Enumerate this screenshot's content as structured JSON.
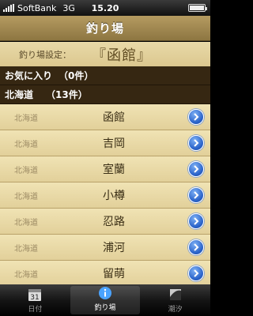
{
  "status": {
    "carrier": "SoftBank",
    "network": "3G",
    "time": "15.20"
  },
  "navbar": {
    "title": "釣り場"
  },
  "setting": {
    "label": "釣り場設定：",
    "value": "『函館』"
  },
  "sections": {
    "favorites": {
      "label": "お気に入り",
      "count": "（0件）"
    },
    "hokkaido": {
      "label": "北海道",
      "count": "（13件）"
    }
  },
  "list": [
    {
      "region": "北海道",
      "name": "函館"
    },
    {
      "region": "北海道",
      "name": "吉岡"
    },
    {
      "region": "北海道",
      "name": "室蘭"
    },
    {
      "region": "北海道",
      "name": "小樽"
    },
    {
      "region": "北海道",
      "name": "忍路"
    },
    {
      "region": "北海道",
      "name": "浦河"
    },
    {
      "region": "北海道",
      "name": "留萌"
    }
  ],
  "tabs": [
    {
      "label": "日付",
      "icon": "calendar-icon",
      "active": false
    },
    {
      "label": "釣り場",
      "icon": "info-icon",
      "active": true
    },
    {
      "label": "潮汐",
      "icon": "tide-icon",
      "active": false
    }
  ]
}
